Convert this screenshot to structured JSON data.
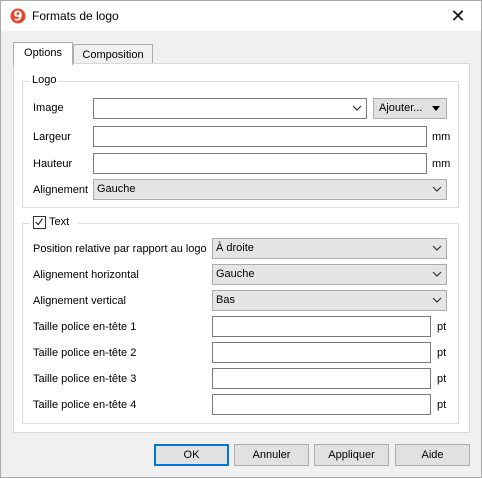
{
  "window": {
    "title": "Formats de logo"
  },
  "tabs": [
    {
      "label": "Options",
      "active": true
    },
    {
      "label": "Composition",
      "active": false
    }
  ],
  "logo_group": {
    "legend": "Logo",
    "image_label": "Image",
    "image_value": "",
    "add_button": "Ajouter...",
    "width_label": "Largeur",
    "width_value": "",
    "width_unit": "mm",
    "height_label": "Hauteur",
    "height_value": "",
    "height_unit": "mm",
    "alignment_label": "Alignement",
    "alignment_value": "Gauche"
  },
  "text_group": {
    "checkbox_label": "Text",
    "checked": true,
    "relative_position_label": "Position relative par rapport au logo",
    "relative_position_value": "À droite",
    "h_align_label": "Alignement horizontal",
    "h_align_value": "Gauche",
    "v_align_label": "Alignement vertical",
    "v_align_value": "Bas",
    "font_sizes": [
      {
        "label": "Taille police en-tête 1",
        "value": "",
        "unit": "pt"
      },
      {
        "label": "Taille police en-tête 2",
        "value": "",
        "unit": "pt"
      },
      {
        "label": "Taille police en-tête 3",
        "value": "",
        "unit": "pt"
      },
      {
        "label": "Taille police en-tête 4",
        "value": "",
        "unit": "pt"
      }
    ]
  },
  "buttons": {
    "ok": "OK",
    "cancel": "Annuler",
    "apply": "Appliquer",
    "help": "Aide"
  },
  "colors": {
    "accent": "#0078d7",
    "app_icon": "#e8452c"
  }
}
